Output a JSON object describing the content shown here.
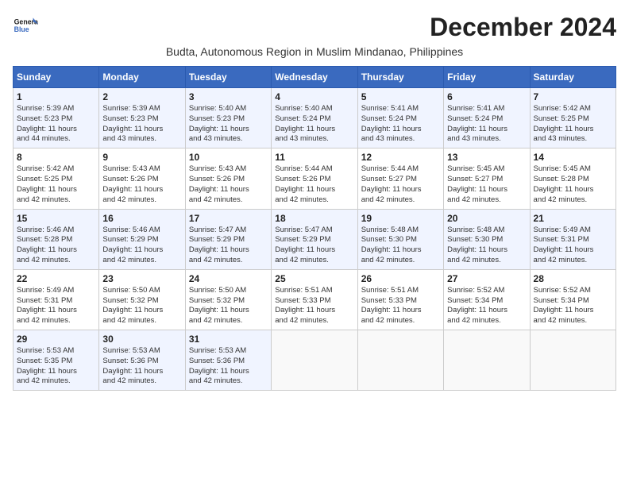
{
  "logo": {
    "line1": "General",
    "line2": "Blue"
  },
  "title": "December 2024",
  "location": "Budta, Autonomous Region in Muslim Mindanao, Philippines",
  "headers": [
    "Sunday",
    "Monday",
    "Tuesday",
    "Wednesday",
    "Thursday",
    "Friday",
    "Saturday"
  ],
  "weeks": [
    [
      {
        "day": "1",
        "info": "Sunrise: 5:39 AM\nSunset: 5:23 PM\nDaylight: 11 hours\nand 44 minutes."
      },
      {
        "day": "2",
        "info": "Sunrise: 5:39 AM\nSunset: 5:23 PM\nDaylight: 11 hours\nand 43 minutes."
      },
      {
        "day": "3",
        "info": "Sunrise: 5:40 AM\nSunset: 5:23 PM\nDaylight: 11 hours\nand 43 minutes."
      },
      {
        "day": "4",
        "info": "Sunrise: 5:40 AM\nSunset: 5:24 PM\nDaylight: 11 hours\nand 43 minutes."
      },
      {
        "day": "5",
        "info": "Sunrise: 5:41 AM\nSunset: 5:24 PM\nDaylight: 11 hours\nand 43 minutes."
      },
      {
        "day": "6",
        "info": "Sunrise: 5:41 AM\nSunset: 5:24 PM\nDaylight: 11 hours\nand 43 minutes."
      },
      {
        "day": "7",
        "info": "Sunrise: 5:42 AM\nSunset: 5:25 PM\nDaylight: 11 hours\nand 43 minutes."
      }
    ],
    [
      {
        "day": "8",
        "info": "Sunrise: 5:42 AM\nSunset: 5:25 PM\nDaylight: 11 hours\nand 42 minutes."
      },
      {
        "day": "9",
        "info": "Sunrise: 5:43 AM\nSunset: 5:26 PM\nDaylight: 11 hours\nand 42 minutes."
      },
      {
        "day": "10",
        "info": "Sunrise: 5:43 AM\nSunset: 5:26 PM\nDaylight: 11 hours\nand 42 minutes."
      },
      {
        "day": "11",
        "info": "Sunrise: 5:44 AM\nSunset: 5:26 PM\nDaylight: 11 hours\nand 42 minutes."
      },
      {
        "day": "12",
        "info": "Sunrise: 5:44 AM\nSunset: 5:27 PM\nDaylight: 11 hours\nand 42 minutes."
      },
      {
        "day": "13",
        "info": "Sunrise: 5:45 AM\nSunset: 5:27 PM\nDaylight: 11 hours\nand 42 minutes."
      },
      {
        "day": "14",
        "info": "Sunrise: 5:45 AM\nSunset: 5:28 PM\nDaylight: 11 hours\nand 42 minutes."
      }
    ],
    [
      {
        "day": "15",
        "info": "Sunrise: 5:46 AM\nSunset: 5:28 PM\nDaylight: 11 hours\nand 42 minutes."
      },
      {
        "day": "16",
        "info": "Sunrise: 5:46 AM\nSunset: 5:29 PM\nDaylight: 11 hours\nand 42 minutes."
      },
      {
        "day": "17",
        "info": "Sunrise: 5:47 AM\nSunset: 5:29 PM\nDaylight: 11 hours\nand 42 minutes."
      },
      {
        "day": "18",
        "info": "Sunrise: 5:47 AM\nSunset: 5:29 PM\nDaylight: 11 hours\nand 42 minutes."
      },
      {
        "day": "19",
        "info": "Sunrise: 5:48 AM\nSunset: 5:30 PM\nDaylight: 11 hours\nand 42 minutes."
      },
      {
        "day": "20",
        "info": "Sunrise: 5:48 AM\nSunset: 5:30 PM\nDaylight: 11 hours\nand 42 minutes."
      },
      {
        "day": "21",
        "info": "Sunrise: 5:49 AM\nSunset: 5:31 PM\nDaylight: 11 hours\nand 42 minutes."
      }
    ],
    [
      {
        "day": "22",
        "info": "Sunrise: 5:49 AM\nSunset: 5:31 PM\nDaylight: 11 hours\nand 42 minutes."
      },
      {
        "day": "23",
        "info": "Sunrise: 5:50 AM\nSunset: 5:32 PM\nDaylight: 11 hours\nand 42 minutes."
      },
      {
        "day": "24",
        "info": "Sunrise: 5:50 AM\nSunset: 5:32 PM\nDaylight: 11 hours\nand 42 minutes."
      },
      {
        "day": "25",
        "info": "Sunrise: 5:51 AM\nSunset: 5:33 PM\nDaylight: 11 hours\nand 42 minutes."
      },
      {
        "day": "26",
        "info": "Sunrise: 5:51 AM\nSunset: 5:33 PM\nDaylight: 11 hours\nand 42 minutes."
      },
      {
        "day": "27",
        "info": "Sunrise: 5:52 AM\nSunset: 5:34 PM\nDaylight: 11 hours\nand 42 minutes."
      },
      {
        "day": "28",
        "info": "Sunrise: 5:52 AM\nSunset: 5:34 PM\nDaylight: 11 hours\nand 42 minutes."
      }
    ],
    [
      {
        "day": "29",
        "info": "Sunrise: 5:53 AM\nSunset: 5:35 PM\nDaylight: 11 hours\nand 42 minutes."
      },
      {
        "day": "30",
        "info": "Sunrise: 5:53 AM\nSunset: 5:36 PM\nDaylight: 11 hours\nand 42 minutes."
      },
      {
        "day": "31",
        "info": "Sunrise: 5:53 AM\nSunset: 5:36 PM\nDaylight: 11 hours\nand 42 minutes."
      },
      null,
      null,
      null,
      null
    ]
  ]
}
